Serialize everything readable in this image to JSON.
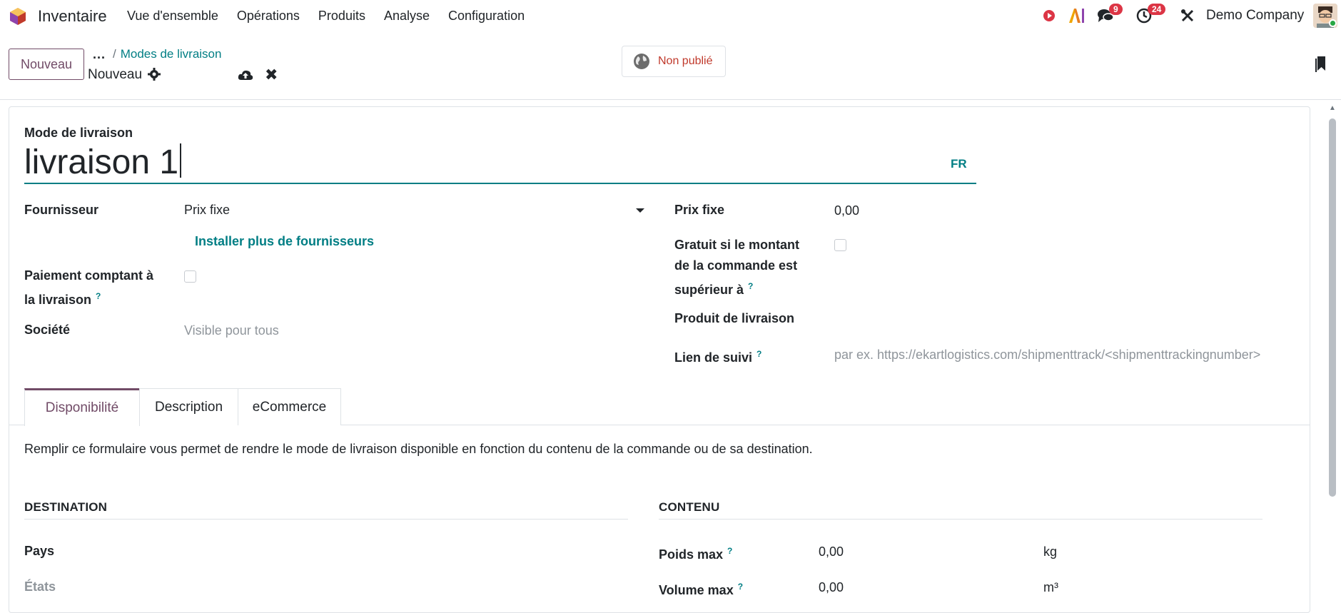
{
  "topnav": {
    "app_name": "Inventaire",
    "menu": [
      "Vue d'ensemble",
      "Opérations",
      "Produits",
      "Analyse",
      "Configuration"
    ],
    "messages_count": "9",
    "activities_count": "24",
    "company": "Demo Company"
  },
  "control": {
    "new_button": "Nouveau",
    "breadcrumb_dots": "...",
    "breadcrumb_sep": "/",
    "breadcrumb_parent": "Modes de livraison",
    "record_name": "Nouveau",
    "publish_label": "Non publié"
  },
  "form": {
    "name_label": "Mode de livraison",
    "name_value": "livraison 1",
    "lang": "FR",
    "provider_label": "Fournisseur",
    "provider_value": "Prix fixe",
    "install_more": "Installer plus de fournisseurs",
    "cod_label_1": "Paiement comptant à",
    "cod_label_2": "la livraison",
    "company_label": "Société",
    "company_placeholder": "Visible pour tous",
    "fixed_price_label": "Prix fixe",
    "fixed_price_value": "0,00",
    "free_label_1": "Gratuit si le montant",
    "free_label_2": "de la commande est",
    "free_label_3": "supérieur à",
    "delivery_product_label": "Produit de livraison",
    "tracking_label": "Lien de suivi",
    "tracking_placeholder": "par ex. https://ekartlogistics.com/shipmenttrack/<shipmenttrackingnumber>",
    "help_mark": "?"
  },
  "tabs": {
    "items": [
      "Disponibilité",
      "Description",
      "eCommerce"
    ],
    "active": "Disponibilité"
  },
  "availability": {
    "description": "Remplir ce formulaire vous permet de rendre le mode de livraison disponible en fonction du contenu de la commande ou de sa destination.",
    "destination_title": "DESTINATION",
    "content_title": "CONTENU",
    "country_label": "Pays",
    "states_label": "États",
    "max_weight_label": "Poids max",
    "max_weight_value": "0,00",
    "weight_unit": "kg",
    "max_volume_label": "Volume max",
    "max_volume_value": "0,00",
    "volume_unit": "m³"
  },
  "colors": {
    "brand": "#714b67",
    "teal": "#017e84",
    "badge": "#dc3545"
  }
}
